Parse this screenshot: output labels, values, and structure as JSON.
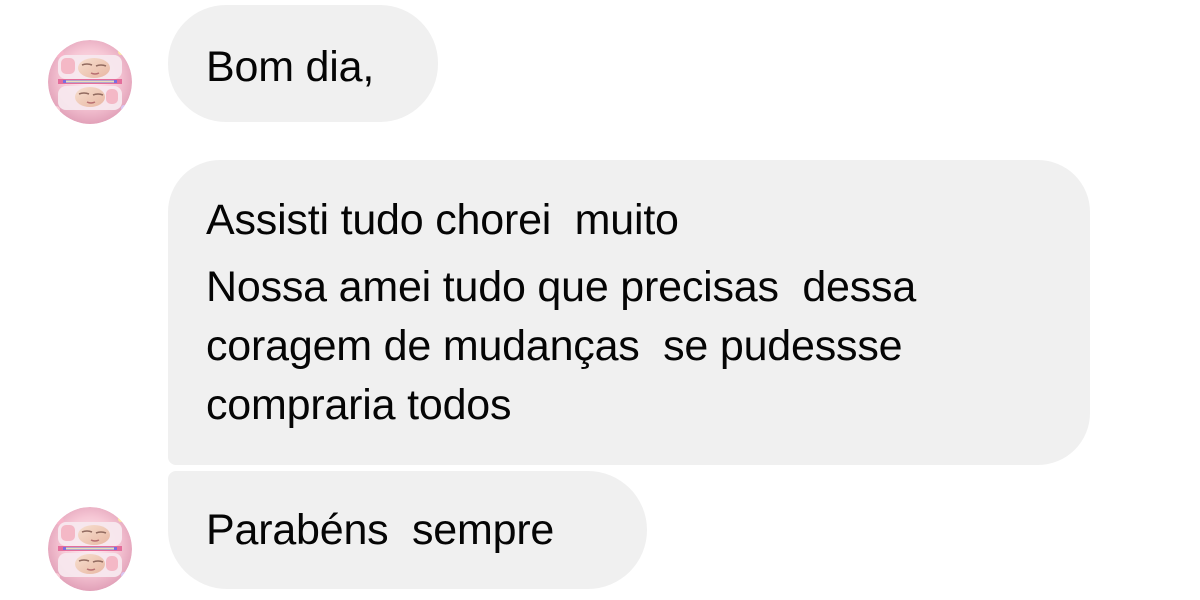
{
  "conversation": {
    "messages": [
      {
        "lines": [
          "Bom dia,"
        ]
      },
      {
        "lines": [
          "Assisti tudo chorei  muito",
          "Nossa amei tudo que precisas  dessa",
          "coragem de mudanças  se pudessse",
          "compraria todos"
        ]
      },
      {
        "lines": [
          "Parabéns  sempre"
        ]
      }
    ]
  },
  "avatar": {
    "icon": "baby-photo-avatar-icon"
  },
  "colors": {
    "background": "#ffffff",
    "bubble": "#f0f0f0",
    "text": "#050505"
  }
}
